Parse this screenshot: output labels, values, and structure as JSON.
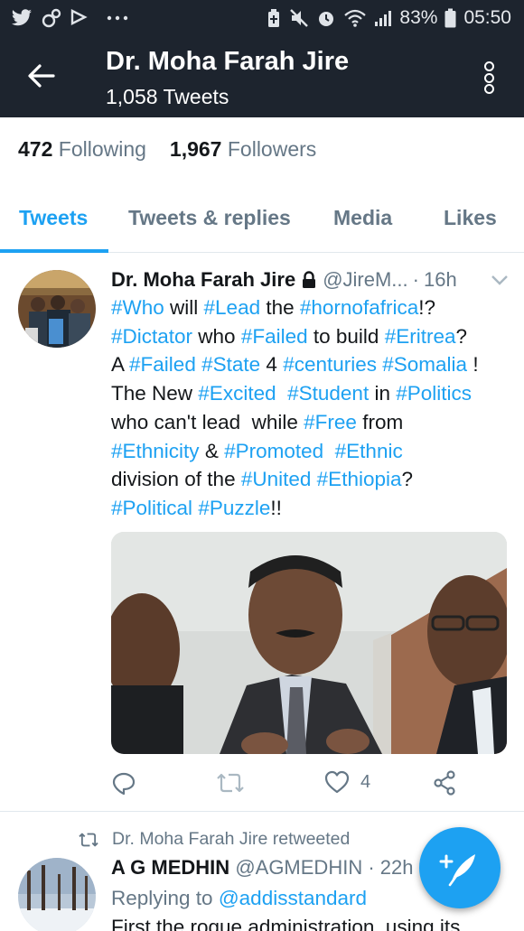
{
  "status_bar": {
    "battery": "83%",
    "time": "05:50",
    "icons": [
      "twitter-icon",
      "link-icon",
      "checklist-icon",
      "more-dots-icon",
      "battery-saver-icon",
      "mute-icon",
      "alarm-icon",
      "wifi-icon",
      "signal-icon",
      "battery-icon"
    ]
  },
  "header": {
    "title": "Dr. Moha Farah Jire",
    "subtitle": "1,058 Tweets"
  },
  "stats": {
    "following_count": "472",
    "following_label": "Following",
    "followers_count": "1,967",
    "followers_label": "Followers"
  },
  "tabs": [
    {
      "label": "Tweets",
      "active": true
    },
    {
      "label": "Tweets & replies",
      "active": false
    },
    {
      "label": "Media",
      "active": false
    },
    {
      "label": "Likes",
      "active": false
    }
  ],
  "tweet": {
    "name": "Dr. Moha Farah Jire",
    "handle": "@JireM...",
    "separator": "·",
    "time": "16h",
    "body_lines": [
      [
        [
          "#Who",
          true
        ],
        [
          " will ",
          false
        ],
        [
          "#Lead",
          true
        ],
        [
          " the ",
          false
        ],
        [
          "#hornofafrica",
          true
        ],
        [
          "!?",
          false
        ]
      ],
      [
        [
          "#Dictator",
          true
        ],
        [
          " who ",
          false
        ],
        [
          "#Failed",
          true
        ],
        [
          " to build ",
          false
        ],
        [
          "#Eritrea",
          true
        ],
        [
          "?",
          false
        ]
      ],
      [
        [
          "A ",
          false
        ],
        [
          "#Failed",
          true
        ],
        [
          " ",
          false
        ],
        [
          "#State",
          true
        ],
        [
          " 4 ",
          false
        ],
        [
          "#centuries",
          true
        ],
        [
          " ",
          false
        ],
        [
          "#Somalia",
          true
        ],
        [
          " !",
          false
        ]
      ],
      [
        [
          "The New ",
          false
        ],
        [
          "#Excited",
          true
        ],
        [
          "  ",
          false
        ],
        [
          "#Student",
          true
        ],
        [
          " in ",
          false
        ],
        [
          "#Politics",
          true
        ]
      ],
      [
        [
          "who can't lead  while ",
          false
        ],
        [
          "#Free",
          true
        ],
        [
          " from",
          false
        ]
      ],
      [
        [
          "#Ethnicity",
          true
        ],
        [
          " & ",
          false
        ],
        [
          "#Promoted",
          true
        ],
        [
          "  ",
          false
        ],
        [
          "#Ethnic",
          true
        ]
      ],
      [
        [
          "division of the ",
          false
        ],
        [
          "#United",
          true
        ],
        [
          " ",
          false
        ],
        [
          "#Ethiopia",
          true
        ],
        [
          "?",
          false
        ]
      ],
      [
        [
          "#Political",
          true
        ],
        [
          " ",
          false
        ],
        [
          "#Puzzle",
          true
        ],
        [
          "!!",
          false
        ]
      ]
    ],
    "like_count": "4"
  },
  "retweet": {
    "retweeted_by": "Dr. Moha Farah Jire retweeted",
    "name": "A G MEDHIN",
    "handle": "@AGMEDHIN",
    "separator": "·",
    "time": "22h",
    "replying_prefix": "Replying to ",
    "replying_to": "@addisstandard",
    "text": "First the rogue administration, using its"
  },
  "colors": {
    "accent": "#1da1f2",
    "header_bg": "#1d242e",
    "secondary_text": "#657786"
  }
}
